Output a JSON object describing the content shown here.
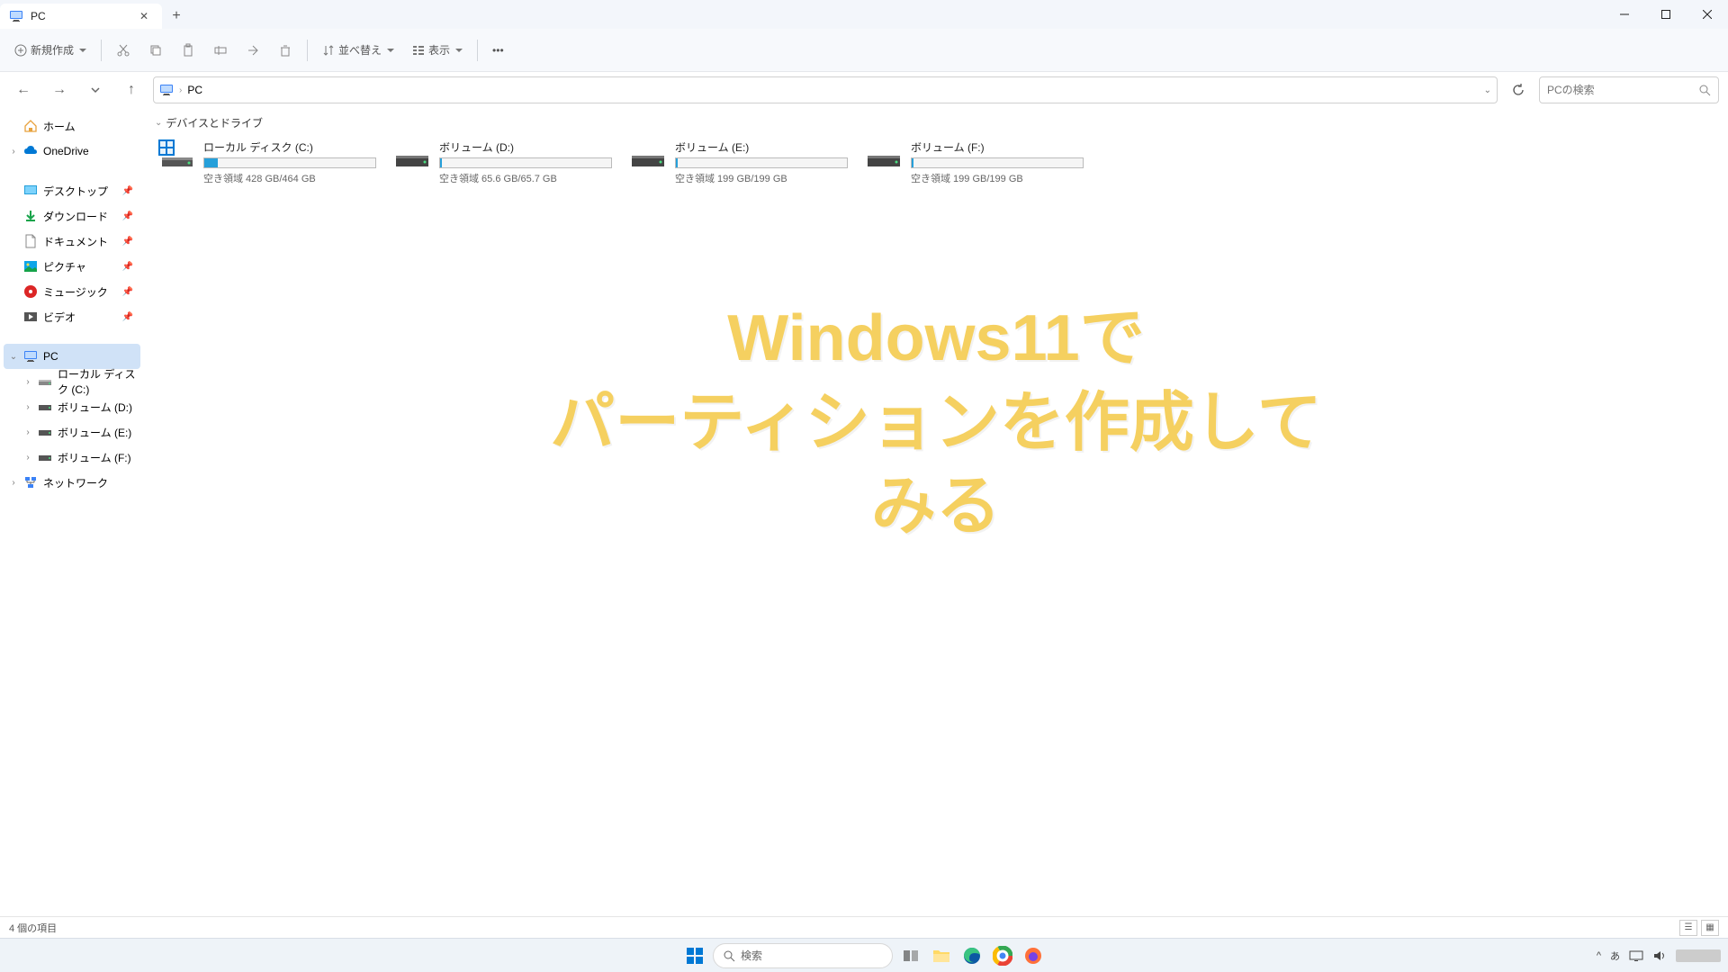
{
  "tab": {
    "title": "PC"
  },
  "toolbar": {
    "new": "新規作成",
    "sort": "並べ替え",
    "view": "表示"
  },
  "address": {
    "location": "PC"
  },
  "search": {
    "placeholder": "PCの検索"
  },
  "sidebar": {
    "home": "ホーム",
    "onedrive": "OneDrive",
    "desktop": "デスクトップ",
    "downloads": "ダウンロード",
    "documents": "ドキュメント",
    "pictures": "ピクチャ",
    "music": "ミュージック",
    "videos": "ビデオ",
    "pc": "PC",
    "localc": "ローカル ディスク (C:)",
    "vold": "ボリューム (D:)",
    "vole": "ボリューム (E:)",
    "volf": "ボリューム (F:)",
    "network": "ネットワーク"
  },
  "section": {
    "header": "デバイスとドライブ"
  },
  "drives": [
    {
      "name": "ローカル ディスク (C:)",
      "space": "空き領域 428 GB/464 GB",
      "fill": 8,
      "system": true
    },
    {
      "name": "ボリューム (D:)",
      "space": "空き領域 65.6 GB/65.7 GB",
      "fill": 1,
      "system": false
    },
    {
      "name": "ボリューム (E:)",
      "space": "空き領域 199 GB/199 GB",
      "fill": 1,
      "system": false
    },
    {
      "name": "ボリューム (F:)",
      "space": "空き領域 199 GB/199 GB",
      "fill": 1,
      "system": false
    }
  ],
  "overlay": {
    "line1": "Windows11で",
    "line2": "パーティションを作成してみる"
  },
  "status": {
    "text": "4 個の項目"
  },
  "taskbar": {
    "search": "検索",
    "lang": "あ"
  }
}
